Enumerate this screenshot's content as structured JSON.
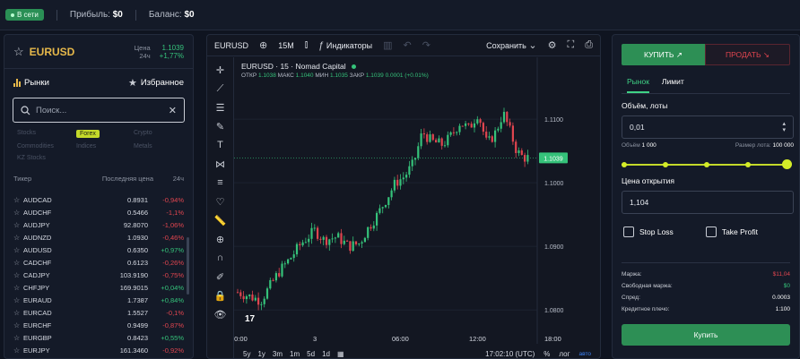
{
  "topbar": {
    "status": "В сети",
    "profit_label": "Прибыль:",
    "profit_value": "$0",
    "balance_label": "Баланс:",
    "balance_value": "$0"
  },
  "symbol": {
    "name": "EURUSD",
    "price_label": "Цена",
    "price_value": "1.1039",
    "change_label": "24ч",
    "change_value": "+1,77%"
  },
  "market_tabs": {
    "markets": "Рынки",
    "favorites": "Избранное"
  },
  "search": {
    "placeholder": "Поиск..."
  },
  "categories": [
    "Stocks",
    "Forex",
    "Crypto",
    "Commodities",
    "Indices",
    "Metals",
    "KZ Stocks"
  ],
  "active_category": "Forex",
  "table": {
    "headers": [
      "Тикер",
      "Последняя цена",
      "24ч"
    ],
    "rows": [
      {
        "ticker": "AUDCAD",
        "price": "0.8931",
        "change": "-0,94%",
        "dir": "neg"
      },
      {
        "ticker": "AUDCHF",
        "price": "0.5466",
        "change": "-1,1%",
        "dir": "neg"
      },
      {
        "ticker": "AUDJPY",
        "price": "92.8070",
        "change": "-1,06%",
        "dir": "neg"
      },
      {
        "ticker": "AUDNZD",
        "price": "1.0930",
        "change": "-0,46%",
        "dir": "neg"
      },
      {
        "ticker": "AUDUSD",
        "price": "0.6350",
        "change": "+0,97%",
        "dir": "pos"
      },
      {
        "ticker": "CADCHF",
        "price": "0.6123",
        "change": "-0,26%",
        "dir": "neg"
      },
      {
        "ticker": "CADJPY",
        "price": "103.9190",
        "change": "-0,75%",
        "dir": "neg"
      },
      {
        "ticker": "CHFJPY",
        "price": "169.9015",
        "change": "+0,04%",
        "dir": "pos"
      },
      {
        "ticker": "EURAUD",
        "price": "1.7387",
        "change": "+0,84%",
        "dir": "pos"
      },
      {
        "ticker": "EURCAD",
        "price": "1.5527",
        "change": "-0,1%",
        "dir": "neg"
      },
      {
        "ticker": "EURCHF",
        "price": "0.9499",
        "change": "-0,87%",
        "dir": "neg"
      },
      {
        "ticker": "EURGBP",
        "price": "0.8423",
        "change": "+0,55%",
        "dir": "pos"
      },
      {
        "ticker": "EURJPY",
        "price": "161.3460",
        "change": "-0,92%",
        "dir": "neg"
      }
    ]
  },
  "chart_toolbar": {
    "symbol": "EURUSD",
    "interval": "15M",
    "indicators": "Индикаторы",
    "save": "Сохранить"
  },
  "chart_legend": {
    "title": "EURUSD · 15 · Nomad Capital",
    "open_label": "ОТКР",
    "open": "1.1038",
    "high_label": "МАКС",
    "high": "1.1040",
    "low_label": "МИН",
    "low": "1.1035",
    "close_label": "ЗАКР",
    "close": "1.1039",
    "change": "0.0001 (+0.01%)"
  },
  "chart_data": {
    "type": "candlestick",
    "y_ticks": [
      "1.1100",
      "1.1000",
      "1.0900",
      "1.0800"
    ],
    "x_ticks": [
      "00:00",
      "3",
      "06:00",
      "12:00",
      "18:00"
    ],
    "last_price": "1.1039",
    "ylim": [
      1.0775,
      1.1155
    ]
  },
  "range_buttons": [
    "5y",
    "1y",
    "3m",
    "1m",
    "5d",
    "1d"
  ],
  "chart_bottom": {
    "time": "17:02:10 (UTC)",
    "percent": "%",
    "log": "лог",
    "auto": "авто"
  },
  "order": {
    "buy": "КУПИТЬ",
    "sell": "ПРОДАТЬ",
    "tab_market": "Рынок",
    "tab_limit": "Лимит",
    "volume_label": "Объём, лоты",
    "volume_value": "0,01",
    "volume_info_label": "Объём",
    "volume_info_value": "1 000",
    "lot_size_label": "Размер лота:",
    "lot_size_value": "100 000",
    "slider_value": 1,
    "open_price_label": "Цена открытия",
    "open_price_value": "1,104",
    "stop_loss": "Stop Loss",
    "take_profit": "Take Profit",
    "margin_label": "Маржа:",
    "margin_value": "$11,04",
    "free_margin_label": "Свободная маржа:",
    "free_margin_value": "$0",
    "spread_label": "Спред:",
    "spread_value": "0.0003",
    "leverage_label": "Кредитное плечо:",
    "leverage_value": "1:100",
    "submit": "Купить"
  },
  "colors": {
    "buy": "#2d8f55",
    "sell": "#e0454f",
    "accent": "#d4ec28",
    "up": "#35c27a",
    "down": "#e0454f"
  }
}
